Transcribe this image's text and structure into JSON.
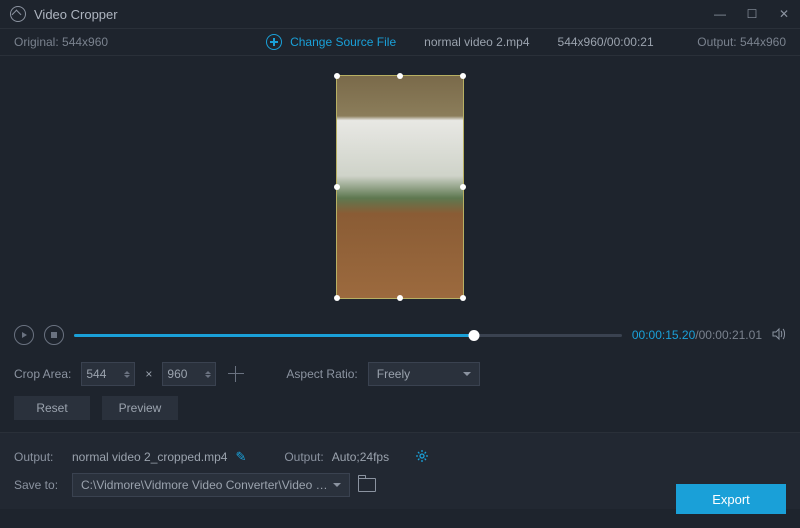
{
  "title": "Video Cropper",
  "original_label": "Original:",
  "original_dims": "544x960",
  "change_source": "Change Source File",
  "file_name": "normal video 2.mp4",
  "file_info": "544x960/00:00:21",
  "output_label": "Output:",
  "output_dims": "544x960",
  "time_current": "00:00:15.20",
  "time_sep": "/",
  "time_total": "00:00:21.01",
  "crop_label": "Crop Area:",
  "crop_w": "544",
  "crop_x": "×",
  "crop_h": "960",
  "aspect_label": "Aspect Ratio:",
  "aspect_value": "Freely",
  "reset": "Reset",
  "preview": "Preview",
  "out_file_label": "Output:",
  "out_file": "normal video 2_cropped.mp4",
  "out_fmt_label": "Output:",
  "out_fmt": "Auto;24fps",
  "save_label": "Save to:",
  "save_path": "C:\\Vidmore\\Vidmore Video Converter\\Video Crop",
  "export": "Export"
}
